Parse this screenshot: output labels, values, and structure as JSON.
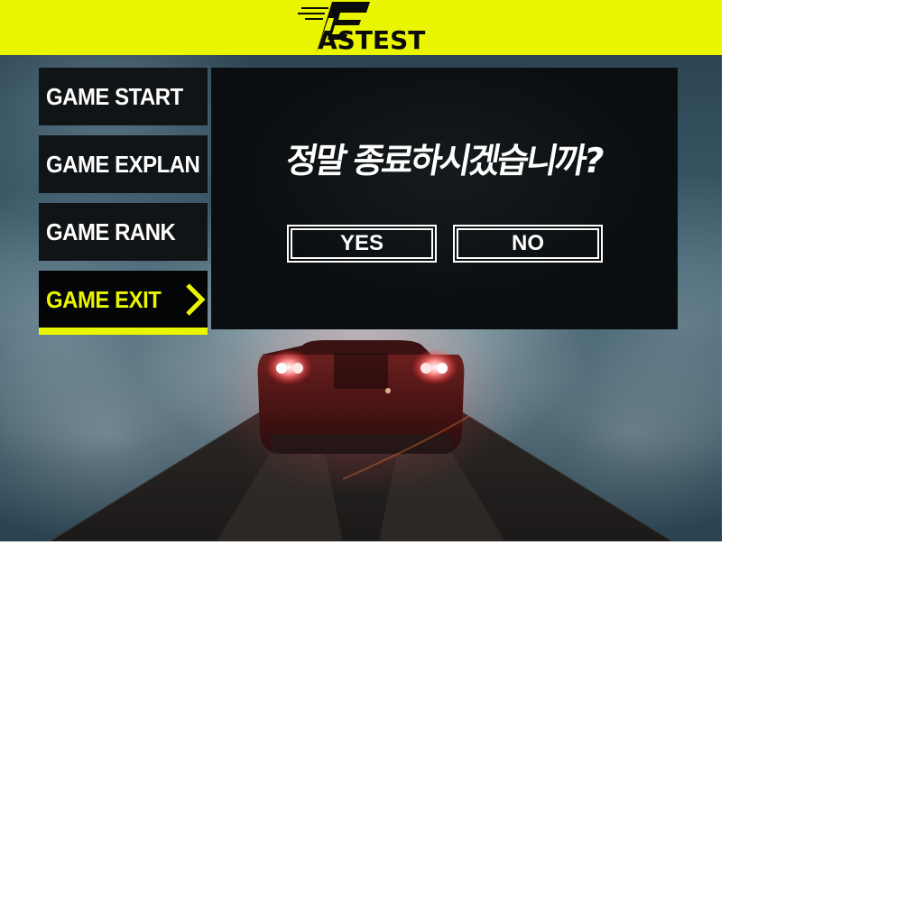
{
  "app": {
    "logo_text": "ASTEST",
    "logo_initial": "F",
    "accent_color": "#eaf500"
  },
  "menu": {
    "items": [
      {
        "label": "GAME START",
        "selected": false
      },
      {
        "label": "GAME EXPLAN",
        "selected": false
      },
      {
        "label": "GAME RANK",
        "selected": false
      },
      {
        "label": "GAME EXIT",
        "selected": true
      }
    ],
    "selected_indicator_icon": "chevron-right-icon"
  },
  "dialog": {
    "message": "정말 종료하시겠습니까?",
    "yes_label": "YES",
    "no_label": "NO"
  },
  "scene": {
    "background": "night road with red car in fog"
  }
}
